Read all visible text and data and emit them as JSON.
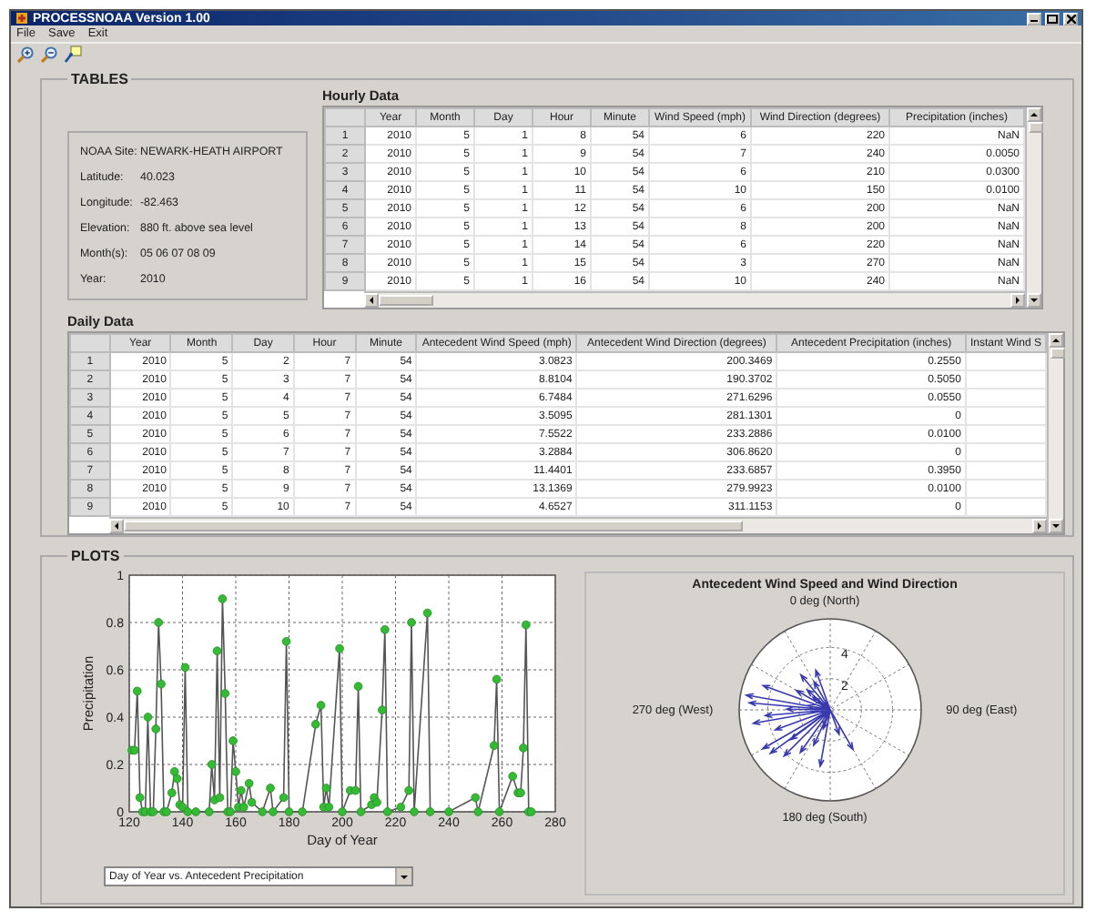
{
  "window": {
    "title": "PROCESSNOAA Version 1.00"
  },
  "menu": [
    "File",
    "Save",
    "Exit"
  ],
  "tables": {
    "title": "TABLES",
    "site_info": [
      {
        "label": "NOAA Site:",
        "value": "NEWARK-HEATH AIRPORT"
      },
      {
        "label": "Latitude:",
        "value": "40.023"
      },
      {
        "label": "Longitude:",
        "value": "-82.463"
      },
      {
        "label": "Elevation:",
        "value": "880 ft. above sea level"
      },
      {
        "label": "Month(s):",
        "value": "05 06 07 08 09"
      },
      {
        "label": "Year:",
        "value": "2010"
      }
    ],
    "hourly": {
      "title": "Hourly Data",
      "columns": [
        "Year",
        "Month",
        "Day",
        "Hour",
        "Minute",
        "Wind Speed (mph)",
        "Wind Direction (degrees)",
        "Precipitation (inches)"
      ],
      "rows": [
        {
          "number": "1",
          "cells": [
            "2010",
            "5",
            "1",
            "8",
            "54",
            "6",
            "220",
            "NaN"
          ]
        },
        {
          "number": "2",
          "cells": [
            "2010",
            "5",
            "1",
            "9",
            "54",
            "7",
            "240",
            "0.0050"
          ]
        },
        {
          "number": "3",
          "cells": [
            "2010",
            "5",
            "1",
            "10",
            "54",
            "6",
            "210",
            "0.0300"
          ]
        },
        {
          "number": "4",
          "cells": [
            "2010",
            "5",
            "1",
            "11",
            "54",
            "10",
            "150",
            "0.0100"
          ]
        },
        {
          "number": "5",
          "cells": [
            "2010",
            "5",
            "1",
            "12",
            "54",
            "6",
            "200",
            "NaN"
          ]
        },
        {
          "number": "6",
          "cells": [
            "2010",
            "5",
            "1",
            "13",
            "54",
            "8",
            "200",
            "NaN"
          ]
        },
        {
          "number": "7",
          "cells": [
            "2010",
            "5",
            "1",
            "14",
            "54",
            "6",
            "220",
            "NaN"
          ]
        },
        {
          "number": "8",
          "cells": [
            "2010",
            "5",
            "1",
            "15",
            "54",
            "3",
            "270",
            "NaN"
          ]
        },
        {
          "number": "9",
          "cells": [
            "2010",
            "5",
            "1",
            "16",
            "54",
            "10",
            "240",
            "NaN"
          ]
        }
      ]
    },
    "daily": {
      "title": "Daily Data",
      "columns": [
        "Year",
        "Month",
        "Day",
        "Hour",
        "Minute",
        "Antecedent Wind Speed (mph)",
        "Antecedent Wind Direction (degrees)",
        "Antecedent Precipitation (inches)",
        "Instant Wind S"
      ],
      "rows": [
        {
          "number": "1",
          "cells": [
            "2010",
            "5",
            "2",
            "7",
            "54",
            "3.0823",
            "200.3469",
            "0.2550",
            ""
          ]
        },
        {
          "number": "2",
          "cells": [
            "2010",
            "5",
            "3",
            "7",
            "54",
            "8.8104",
            "190.3702",
            "0.5050",
            ""
          ]
        },
        {
          "number": "3",
          "cells": [
            "2010",
            "5",
            "4",
            "7",
            "54",
            "6.7484",
            "271.6296",
            "0.0550",
            ""
          ]
        },
        {
          "number": "4",
          "cells": [
            "2010",
            "5",
            "5",
            "7",
            "54",
            "3.5095",
            "281.1301",
            "0",
            ""
          ]
        },
        {
          "number": "5",
          "cells": [
            "2010",
            "5",
            "6",
            "7",
            "54",
            "7.5522",
            "233.2886",
            "0.0100",
            ""
          ]
        },
        {
          "number": "6",
          "cells": [
            "2010",
            "5",
            "7",
            "7",
            "54",
            "3.2884",
            "306.8620",
            "0",
            ""
          ]
        },
        {
          "number": "7",
          "cells": [
            "2010",
            "5",
            "8",
            "7",
            "54",
            "11.4401",
            "233.6857",
            "0.3950",
            ""
          ]
        },
        {
          "number": "8",
          "cells": [
            "2010",
            "5",
            "9",
            "7",
            "54",
            "13.1369",
            "279.9923",
            "0.0100",
            ""
          ]
        },
        {
          "number": "9",
          "cells": [
            "2010",
            "5",
            "10",
            "7",
            "54",
            "4.6527",
            "311.1153",
            "0",
            ""
          ]
        }
      ]
    }
  },
  "plots": {
    "title": "PLOTS",
    "chart_data": {
      "type": "line",
      "xlabel": "Day of Year",
      "ylabel": "Precipitation",
      "xlim": [
        120,
        280
      ],
      "ylim": [
        0,
        1
      ],
      "xticks": [
        120,
        140,
        160,
        180,
        200,
        220,
        240,
        260,
        280
      ],
      "yticks": [
        0,
        0.2,
        0.4,
        0.6,
        0.8,
        1
      ],
      "x": [
        121,
        122,
        123,
        124,
        125,
        126,
        127,
        128,
        129,
        130,
        131,
        132,
        133,
        134,
        136,
        137,
        138,
        139,
        140,
        141,
        142,
        145,
        150,
        151,
        152,
        153,
        154,
        155,
        156,
        157,
        158,
        159,
        160,
        161,
        162,
        163,
        165,
        166,
        170,
        173,
        174,
        178,
        179,
        180,
        185,
        190,
        192,
        193,
        194,
        195,
        199,
        200,
        203,
        205,
        206,
        207,
        211,
        212,
        213,
        215,
        216,
        217,
        222,
        225,
        226,
        227,
        232,
        233,
        240,
        250,
        251,
        257,
        258,
        259,
        264,
        266,
        267,
        268,
        269,
        270,
        271
      ],
      "grid": true,
      "series": [
        {
          "color": "#33bb33",
          "marker": "circle",
          "values": [
            0.26,
            0.26,
            0.51,
            0.06,
            0,
            0,
            0.4,
            0,
            0,
            0.35,
            0.8,
            0.54,
            0,
            0,
            0.08,
            0.17,
            0.14,
            0.03,
            0.02,
            0.61,
            0,
            0,
            0,
            0.2,
            0.05,
            0.68,
            0.06,
            0.9,
            0.5,
            0,
            0,
            0.3,
            0.17,
            0.02,
            0.09,
            0.02,
            0.12,
            0.04,
            0,
            0.1,
            0,
            0.06,
            0.72,
            0,
            0,
            0.37,
            0.45,
            0.02,
            0.1,
            0.02,
            0.69,
            0,
            0.09,
            0.09,
            0.53,
            0,
            0.03,
            0.06,
            0.04,
            0.43,
            0.77,
            0,
            0.02,
            0.09,
            0.8,
            0,
            0.84,
            0,
            0,
            0.06,
            0,
            0.28,
            0.56,
            0,
            0.15,
            0.08,
            0.08,
            0.27,
            0.79,
            0,
            0
          ]
        }
      ]
    },
    "selector": {
      "value": "Day of Year vs. Antecedent Precipitation"
    },
    "compass": {
      "title": "Antecedent Wind Speed and Wind Direction",
      "north": "0 deg (North)",
      "east": "90 deg (East)",
      "south": "180 deg (South)",
      "west": "270 deg (West)",
      "rings": [
        "4",
        "2"
      ]
    }
  }
}
